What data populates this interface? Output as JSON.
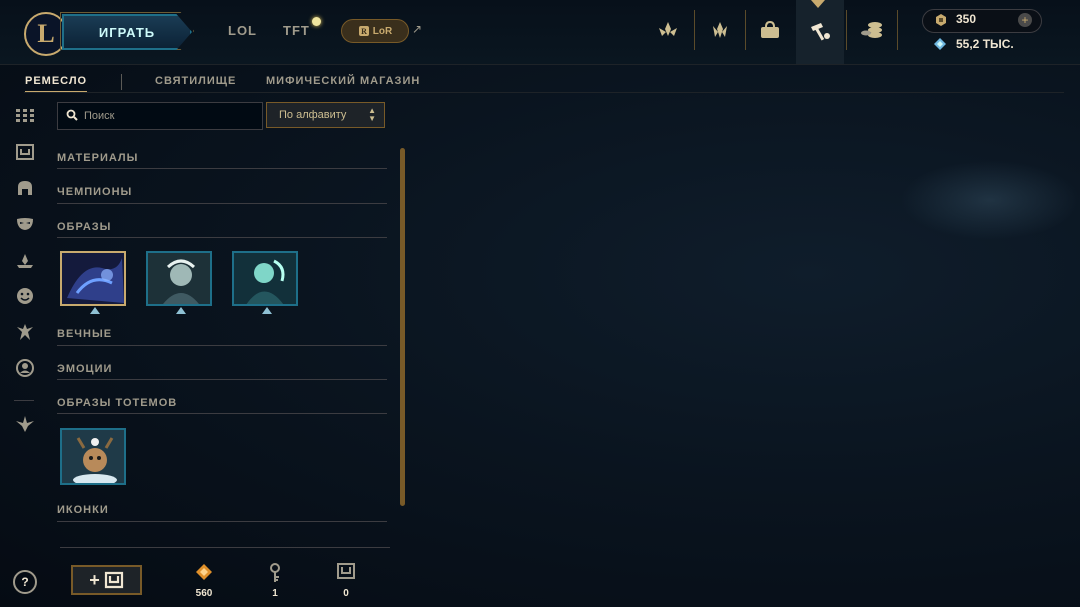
{
  "header": {
    "logo_letter": "L",
    "play_label": "ИГРАТЬ",
    "nav": [
      "LOL",
      "TFT"
    ],
    "lor_label": "LoR",
    "lor_ext": "↗",
    "icons": [
      "clash-icon",
      "ranked-icon",
      "store-icon",
      "crafting-icon",
      "collection-icon"
    ]
  },
  "wallet": {
    "rp": "350",
    "plus": "+",
    "blue_essence": "55,2 ТЫС."
  },
  "subtabs": [
    "РЕМЕСЛО",
    "СВЯТИЛИЩЕ",
    "МИФИЧЕСКИЙ МАГАЗИН"
  ],
  "search": {
    "placeholder": "Поиск"
  },
  "sort": {
    "label": "По алфавиту"
  },
  "categories": {
    "materials": "МАТЕРИАЛЫ",
    "champions": "ЧЕМПИОНЫ",
    "skins": "ОБРАЗЫ",
    "eternals": "ВЕЧНЫЕ",
    "emotes": "ЭМОЦИИ",
    "ward_skins": "ОБРАЗЫ ТОТЕМОВ",
    "icons": "ИКОНКИ"
  },
  "bottom": {
    "help": "?",
    "add": "+",
    "orange_essence": "560",
    "keys": "1",
    "chests": "0"
  },
  "colors": {
    "gold": "#c8aa6e",
    "teal": "#1e6f89",
    "bg": "#0a141f"
  }
}
